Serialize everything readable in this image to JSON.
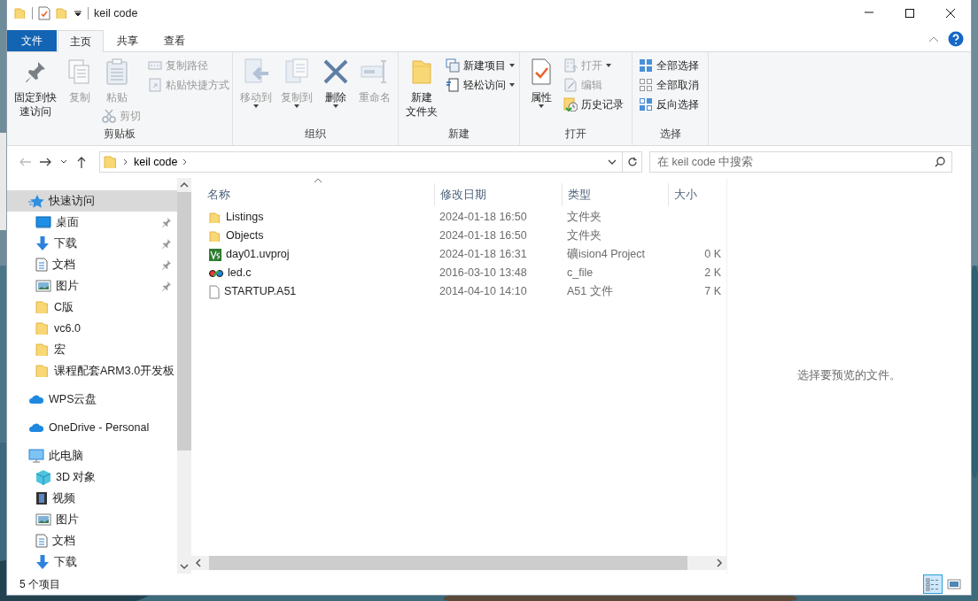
{
  "window": {
    "title": "keil code"
  },
  "ribbon_tabs": [
    {
      "label": "文件",
      "kind": "file",
      "selected": false
    },
    {
      "label": "主页",
      "kind": "tab",
      "selected": true
    },
    {
      "label": "共享",
      "kind": "tab",
      "selected": false
    },
    {
      "label": "查看",
      "kind": "tab",
      "selected": false
    }
  ],
  "ribbon_groups": [
    {
      "label": "剪贴板",
      "columns": [
        [
          {
            "kind": "large",
            "lines": [
              "固定到快",
              "速访问"
            ],
            "disabled": false,
            "dropdown": false
          }
        ],
        [
          {
            "kind": "large",
            "lines": [
              "复制"
            ],
            "disabled": true,
            "dropdown": false
          }
        ],
        [
          {
            "kind": "large",
            "lines": [
              "粘贴"
            ],
            "disabled": true,
            "dropdown": false
          },
          {
            "kind": "small",
            "lines": [
              "剪切"
            ],
            "disabled": true,
            "dropdown": false
          }
        ],
        [
          {
            "kind": "small",
            "lines": [
              "复制路径"
            ],
            "disabled": true,
            "dropdown": false
          },
          {
            "kind": "small",
            "lines": [
              "粘贴快捷方式"
            ],
            "disabled": true,
            "dropdown": false
          }
        ]
      ]
    },
    {
      "label": "组织",
      "columns": [
        [
          {
            "kind": "large",
            "lines": [
              "移动到"
            ],
            "disabled": true,
            "dropdown": true
          }
        ],
        [
          {
            "kind": "large",
            "lines": [
              "复制到"
            ],
            "disabled": true,
            "dropdown": true
          }
        ],
        [
          {
            "kind": "large",
            "lines": [
              "删除"
            ],
            "disabled": false,
            "dropdown": true
          }
        ],
        [
          {
            "kind": "large",
            "lines": [
              "重命名"
            ],
            "disabled": true,
            "dropdown": false
          }
        ]
      ]
    },
    {
      "label": "新建",
      "columns": [
        [
          {
            "kind": "large",
            "lines": [
              "新建",
              "文件夹"
            ],
            "disabled": false,
            "dropdown": false
          }
        ],
        [
          {
            "kind": "small",
            "lines": [
              "新建项目"
            ],
            "disabled": false,
            "dropdown": true
          },
          {
            "kind": "small",
            "lines": [
              "轻松访问"
            ],
            "disabled": false,
            "dropdown": true
          }
        ]
      ]
    },
    {
      "label": "打开",
      "columns": [
        [
          {
            "kind": "large",
            "lines": [
              "属性"
            ],
            "disabled": false,
            "dropdown": true
          }
        ],
        [
          {
            "kind": "small",
            "lines": [
              "打开"
            ],
            "disabled": true,
            "dropdown": true
          },
          {
            "kind": "small",
            "lines": [
              "编辑"
            ],
            "disabled": true,
            "dropdown": false
          },
          {
            "kind": "small",
            "lines": [
              "历史记录"
            ],
            "disabled": false,
            "dropdown": false
          }
        ]
      ]
    },
    {
      "label": "选择",
      "columns": [
        [
          {
            "kind": "small",
            "lines": [
              "全部选择"
            ],
            "disabled": false,
            "dropdown": false
          },
          {
            "kind": "small",
            "lines": [
              "全部取消"
            ],
            "disabled": false,
            "dropdown": false
          },
          {
            "kind": "small",
            "lines": [
              "反向选择"
            ],
            "disabled": false,
            "dropdown": false
          }
        ]
      ]
    }
  ],
  "address": {
    "path": [
      "keil code"
    ],
    "search_placeholder": "在 keil code 中搜索"
  },
  "navigation": [
    {
      "label": "快速访问",
      "kind": "star",
      "selected": true,
      "pinned": false,
      "children": [
        {
          "label": "桌面",
          "kind": "desktop",
          "selected": false,
          "pinned": true
        },
        {
          "label": "下载",
          "kind": "download",
          "selected": false,
          "pinned": true
        },
        {
          "label": "文档",
          "kind": "document",
          "selected": false,
          "pinned": true
        },
        {
          "label": "图片",
          "kind": "pictures",
          "selected": false,
          "pinned": true
        },
        {
          "label": "C版",
          "kind": "folder",
          "selected": false,
          "pinned": false
        },
        {
          "label": "vc6.0",
          "kind": "folder",
          "selected": false,
          "pinned": false
        },
        {
          "label": "宏",
          "kind": "folder",
          "selected": false,
          "pinned": false
        },
        {
          "label": "课程配套ARM3.0开发板",
          "kind": "folder",
          "selected": false,
          "pinned": false
        }
      ]
    },
    {
      "label": "WPS云盘",
      "kind": "cloud",
      "selected": false,
      "pinned": false
    },
    {
      "label": "OneDrive - Personal",
      "kind": "cloud",
      "selected": false,
      "pinned": false
    },
    {
      "label": "此电脑",
      "kind": "pc",
      "selected": false,
      "pinned": false,
      "children": [
        {
          "label": "3D 对象",
          "kind": "cube",
          "selected": false,
          "pinned": false
        },
        {
          "label": "视频",
          "kind": "video",
          "selected": false,
          "pinned": false
        },
        {
          "label": "图片",
          "kind": "pictures",
          "selected": false,
          "pinned": false
        },
        {
          "label": "文档",
          "kind": "document",
          "selected": false,
          "pinned": false
        },
        {
          "label": "下载",
          "kind": "download",
          "selected": false,
          "pinned": false
        }
      ]
    }
  ],
  "file_columns": [
    {
      "label": "名称",
      "sorted": true
    },
    {
      "label": "修改日期",
      "sorted": false
    },
    {
      "label": "类型",
      "sorted": false
    },
    {
      "label": "大小",
      "sorted": false
    }
  ],
  "files": [
    {
      "name": "Listings",
      "modified": "2024-01-18 16:50",
      "type": "文件夹",
      "kind": "folder"
    },
    {
      "name": "Objects",
      "modified": "2024-01-18 16:50",
      "type": "文件夹",
      "kind": "folder"
    },
    {
      "name": "day01.uvproj",
      "modified": "2024-01-18 16:31",
      "type": "礦ision4 Project",
      "size": "0 K",
      "kind": "project"
    },
    {
      "name": "led.c",
      "modified": "2016-03-10 13:48",
      "type": "c_file",
      "size": "2 K",
      "kind": "source"
    },
    {
      "name": "STARTUP.A51",
      "modified": "2014-04-10 14:10",
      "type": "A51 文件",
      "size": "7 K",
      "kind": "file"
    }
  ],
  "preview": {
    "message": "选择要预览的文件。"
  },
  "status_bar": {
    "item_count": "5 个项目",
    "views": [
      {
        "kind": "details",
        "selected": true
      },
      {
        "kind": "large-icons",
        "selected": false
      }
    ]
  }
}
